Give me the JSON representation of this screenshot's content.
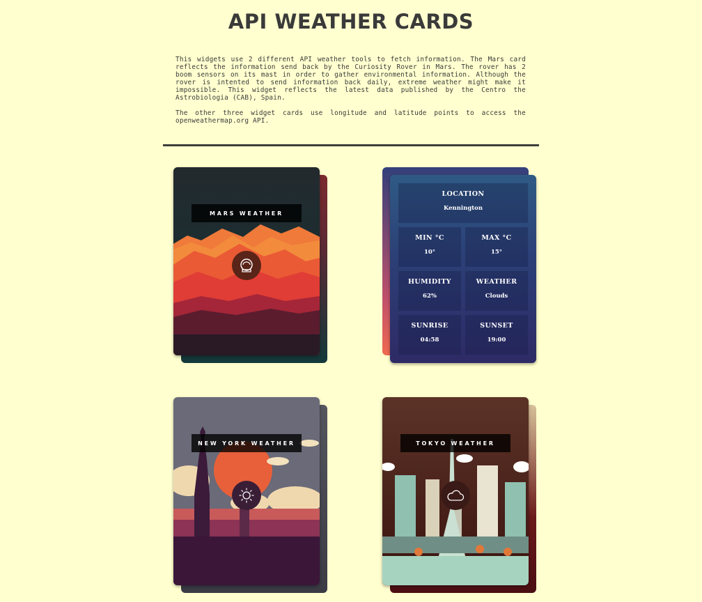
{
  "page": {
    "title": "API WEATHER CARDS",
    "intro_p1": "This widgets use 2 different API weather tools to fetch information. The Mars card reflects the information send back by the Curiosity Rover in Mars. The rover has 2 boom sensors on its mast in order to gather environmental information. Although the rover is intented to send information back daily, extreme weather might make it impossible. This widget reflects the latest data published by the Centro the Astrobiologia (CAB), Spain.",
    "intro_p2": "The other three widget cards use longitude and latitude points to access the openweathermap.org API."
  },
  "cards": {
    "mars": {
      "label": "MARS WEATHER",
      "icon": "astronaut-helmet-icon"
    },
    "new_york": {
      "label": "NEW YORK WEATHER",
      "icon": "sun-icon"
    },
    "tokyo": {
      "label": "TOKYO WEATHER",
      "icon": "cloud-icon"
    }
  },
  "info": {
    "location_label": "LOCATION",
    "location_value": "Kennington",
    "min_label": "MIN °C",
    "min_value": "10°",
    "max_label": "MAX °C",
    "max_value": "15°",
    "humidity_label": "HUMIDITY",
    "humidity_value": "62%",
    "weather_label": "WEATHER",
    "weather_value": "Clouds",
    "sunrise_label": "SUNRISE",
    "sunrise_value": "04:58",
    "sunset_label": "SUNSET",
    "sunset_value": "19:00"
  },
  "colors": {
    "page_bg": "#ffffcf",
    "text": "#3a3a3a",
    "panel_top": "#2f5a85",
    "panel_bottom": "#2e2a66"
  }
}
